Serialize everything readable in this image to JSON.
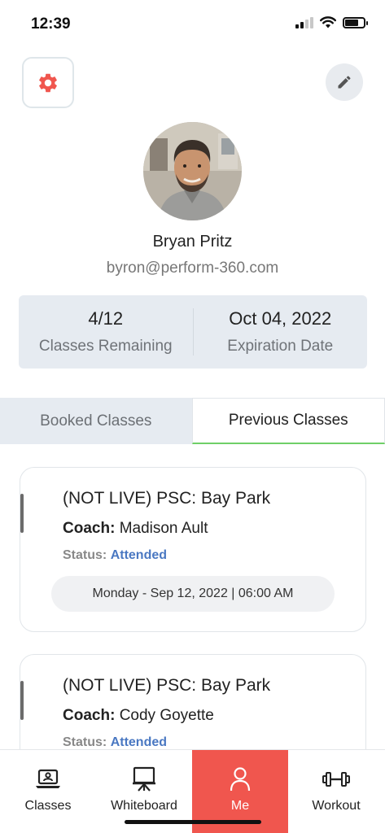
{
  "status_bar": {
    "time": "12:39"
  },
  "profile": {
    "name": "Bryan Pritz",
    "email": "byron@perform-360.com"
  },
  "stats": {
    "classes_remaining_value": "4/12",
    "classes_remaining_label": "Classes Remaining",
    "expiration_value": "Oct 04, 2022",
    "expiration_label": "Expiration Date"
  },
  "tabs": {
    "booked": "Booked Classes",
    "previous": "Previous Classes",
    "active": "previous"
  },
  "classes": [
    {
      "title": "(NOT LIVE) PSC: Bay Park",
      "coach_label": "Coach:",
      "coach": "Madison Ault",
      "status_label": "Status:",
      "status": "Attended",
      "date": "Monday - Sep 12, 2022 | 06:00 AM"
    },
    {
      "title": "(NOT LIVE) PSC: Bay Park",
      "coach_label": "Coach:",
      "coach": "Cody Goyette",
      "status_label": "Status:",
      "status": "Attended"
    }
  ],
  "nav": {
    "items": [
      {
        "label": "Classes",
        "icon": "laptop-user-icon"
      },
      {
        "label": "Whiteboard",
        "icon": "whiteboard-icon"
      },
      {
        "label": "Me",
        "icon": "person-icon"
      },
      {
        "label": "Workout",
        "icon": "dumbbell-icon"
      }
    ],
    "active": "Me"
  },
  "colors": {
    "accent": "#f0564e",
    "status_attended": "#4a78c2",
    "tab_underline": "#6fcf67",
    "panel_bg": "#e6ebf1"
  },
  "icons": {
    "settings": "gear-icon",
    "edit": "pencil-icon"
  }
}
